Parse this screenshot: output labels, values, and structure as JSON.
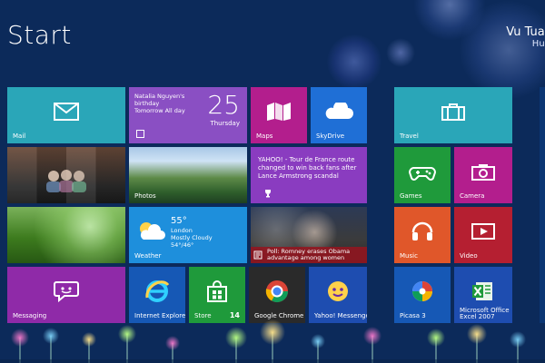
{
  "screen": {
    "title": "Start",
    "user": {
      "name": "Vu Tuan",
      "subtitle": "Hun"
    },
    "accent": "#0c2a5a"
  },
  "tiles": {
    "mail": {
      "label": "Mail",
      "color": "#2aa6b8",
      "icon": "mail-icon"
    },
    "calendar": {
      "label": "",
      "text": "Natalia Nguyen's birthday\nTomorrow All day",
      "day_number": "25",
      "day_name": "Thursday",
      "color": "#8a4fc3",
      "icon": "calendar-icon"
    },
    "maps": {
      "label": "Maps",
      "color": "#b31e8d",
      "icon": "map-icon"
    },
    "skydrive": {
      "label": "SkyDrive",
      "color": "#1f6fd6",
      "icon": "cloud-icon"
    },
    "people": {
      "label": "",
      "color": "#3a3a3a",
      "icon": "people-icon"
    },
    "photos": {
      "label": "Photos",
      "color": "#2f6b33",
      "icon": "photo-icon"
    },
    "news": {
      "label": "",
      "text": "YAHOO! - Tour de France route changed to win back fans after Lance Armstrong scandal",
      "color": "#8a3cc0",
      "icon": "trophy-icon"
    },
    "desktop": {
      "label": "",
      "color": "#3f7f1a",
      "icon": "desktop-icon"
    },
    "weather": {
      "label": "Weather",
      "degree": "55°",
      "info": "London\nMostly Cloudy\n54°/46°",
      "color": "#1e8fdc",
      "icon": "weather-icon"
    },
    "headlines": {
      "label": "",
      "ticker": "Poll: Romney erases Obama advantage among women",
      "color": "#b51f31",
      "icon": "news-icon"
    },
    "messaging": {
      "label": "Messaging",
      "color": "#8f2aa8",
      "icon": "message-icon"
    },
    "ie": {
      "label": "Internet Explorer",
      "color": "#1658b5",
      "icon": "ie-icon"
    },
    "store": {
      "label": "Store",
      "badge": "14",
      "color": "#1f9a3b",
      "icon": "store-icon"
    },
    "chrome": {
      "label": "Google Chrome",
      "color": "#2a2a2a",
      "icon": "chrome-icon"
    },
    "yahoo_messenger": {
      "label": "Yahoo! Messenger",
      "color": "#1e4db0",
      "icon": "yahoo-icon"
    },
    "travel": {
      "label": "Travel",
      "color": "#2aa6b8",
      "icon": "briefcase-icon"
    },
    "games": {
      "label": "Games",
      "color": "#1f9a3b",
      "icon": "gamepad-icon"
    },
    "camera": {
      "label": "Camera",
      "color": "#b31e8d",
      "icon": "camera-icon"
    },
    "music": {
      "label": "Music",
      "color": "#e0572a",
      "icon": "headphones-icon"
    },
    "video": {
      "label": "Video",
      "color": "#b51f31",
      "icon": "video-icon"
    },
    "picasa": {
      "label": "Picasa 3",
      "color": "#1658b5",
      "icon": "picasa-icon"
    },
    "excel": {
      "label": "Microsoft Office Excel 2007",
      "color": "#1e4db0",
      "icon": "excel-icon"
    }
  }
}
